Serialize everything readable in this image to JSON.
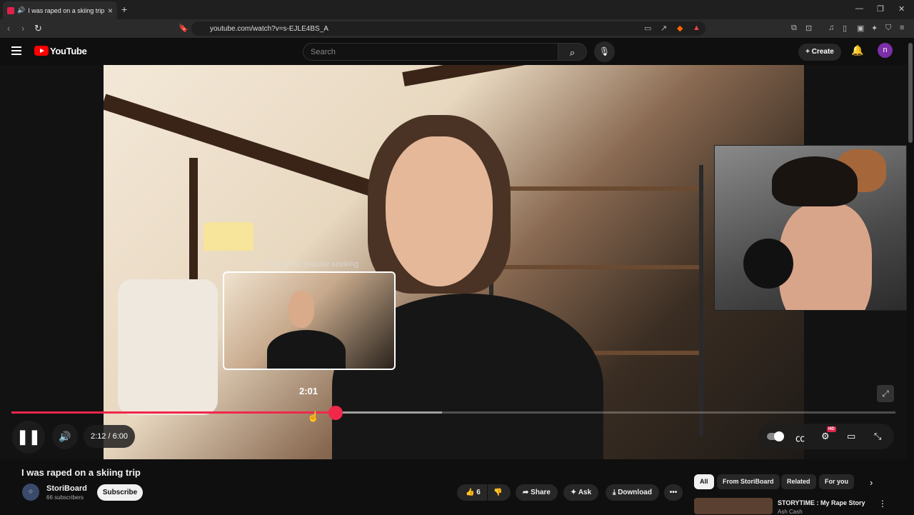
{
  "browser": {
    "tab_title": "I was raped on a skiing trip -",
    "speaker_icon": "speaker-icon",
    "close_tab": "×",
    "new_tab": "+",
    "url": "youtube.com/watch?v=s-EJLE4BS_A",
    "window_controls": [
      "—",
      "❐",
      "✕"
    ]
  },
  "youtube": {
    "logo_text": "YouTube",
    "search_placeholder": "Search",
    "create_label": "Create",
    "avatar_letter": "n"
  },
  "player": {
    "pull_hint": "⌃ Pull up for precise seeking",
    "seek_time": "2:01",
    "time_display": "2:12 / 6:00",
    "played_fraction": 0.367,
    "buffered_fraction": 0.487,
    "hd_badge": "HD"
  },
  "video": {
    "title": "I was raped on a skiing trip",
    "channel_name": "StoriBoard",
    "subscribers": "66 subscribers",
    "subscribe_label": "Subscribe",
    "likes": "6",
    "share_label": "Share",
    "ask_label": "Ask",
    "download_label": "Download"
  },
  "chips": [
    "All",
    "From StoriBoard",
    "Related",
    "For you"
  ],
  "recommendation": {
    "title": "STORYTIME : My Rape Story",
    "channel": "Ash Cash"
  },
  "colors": {
    "accent": "#f0284a",
    "background": "#0f0f0f",
    "youtube_red": "#ff0000"
  }
}
